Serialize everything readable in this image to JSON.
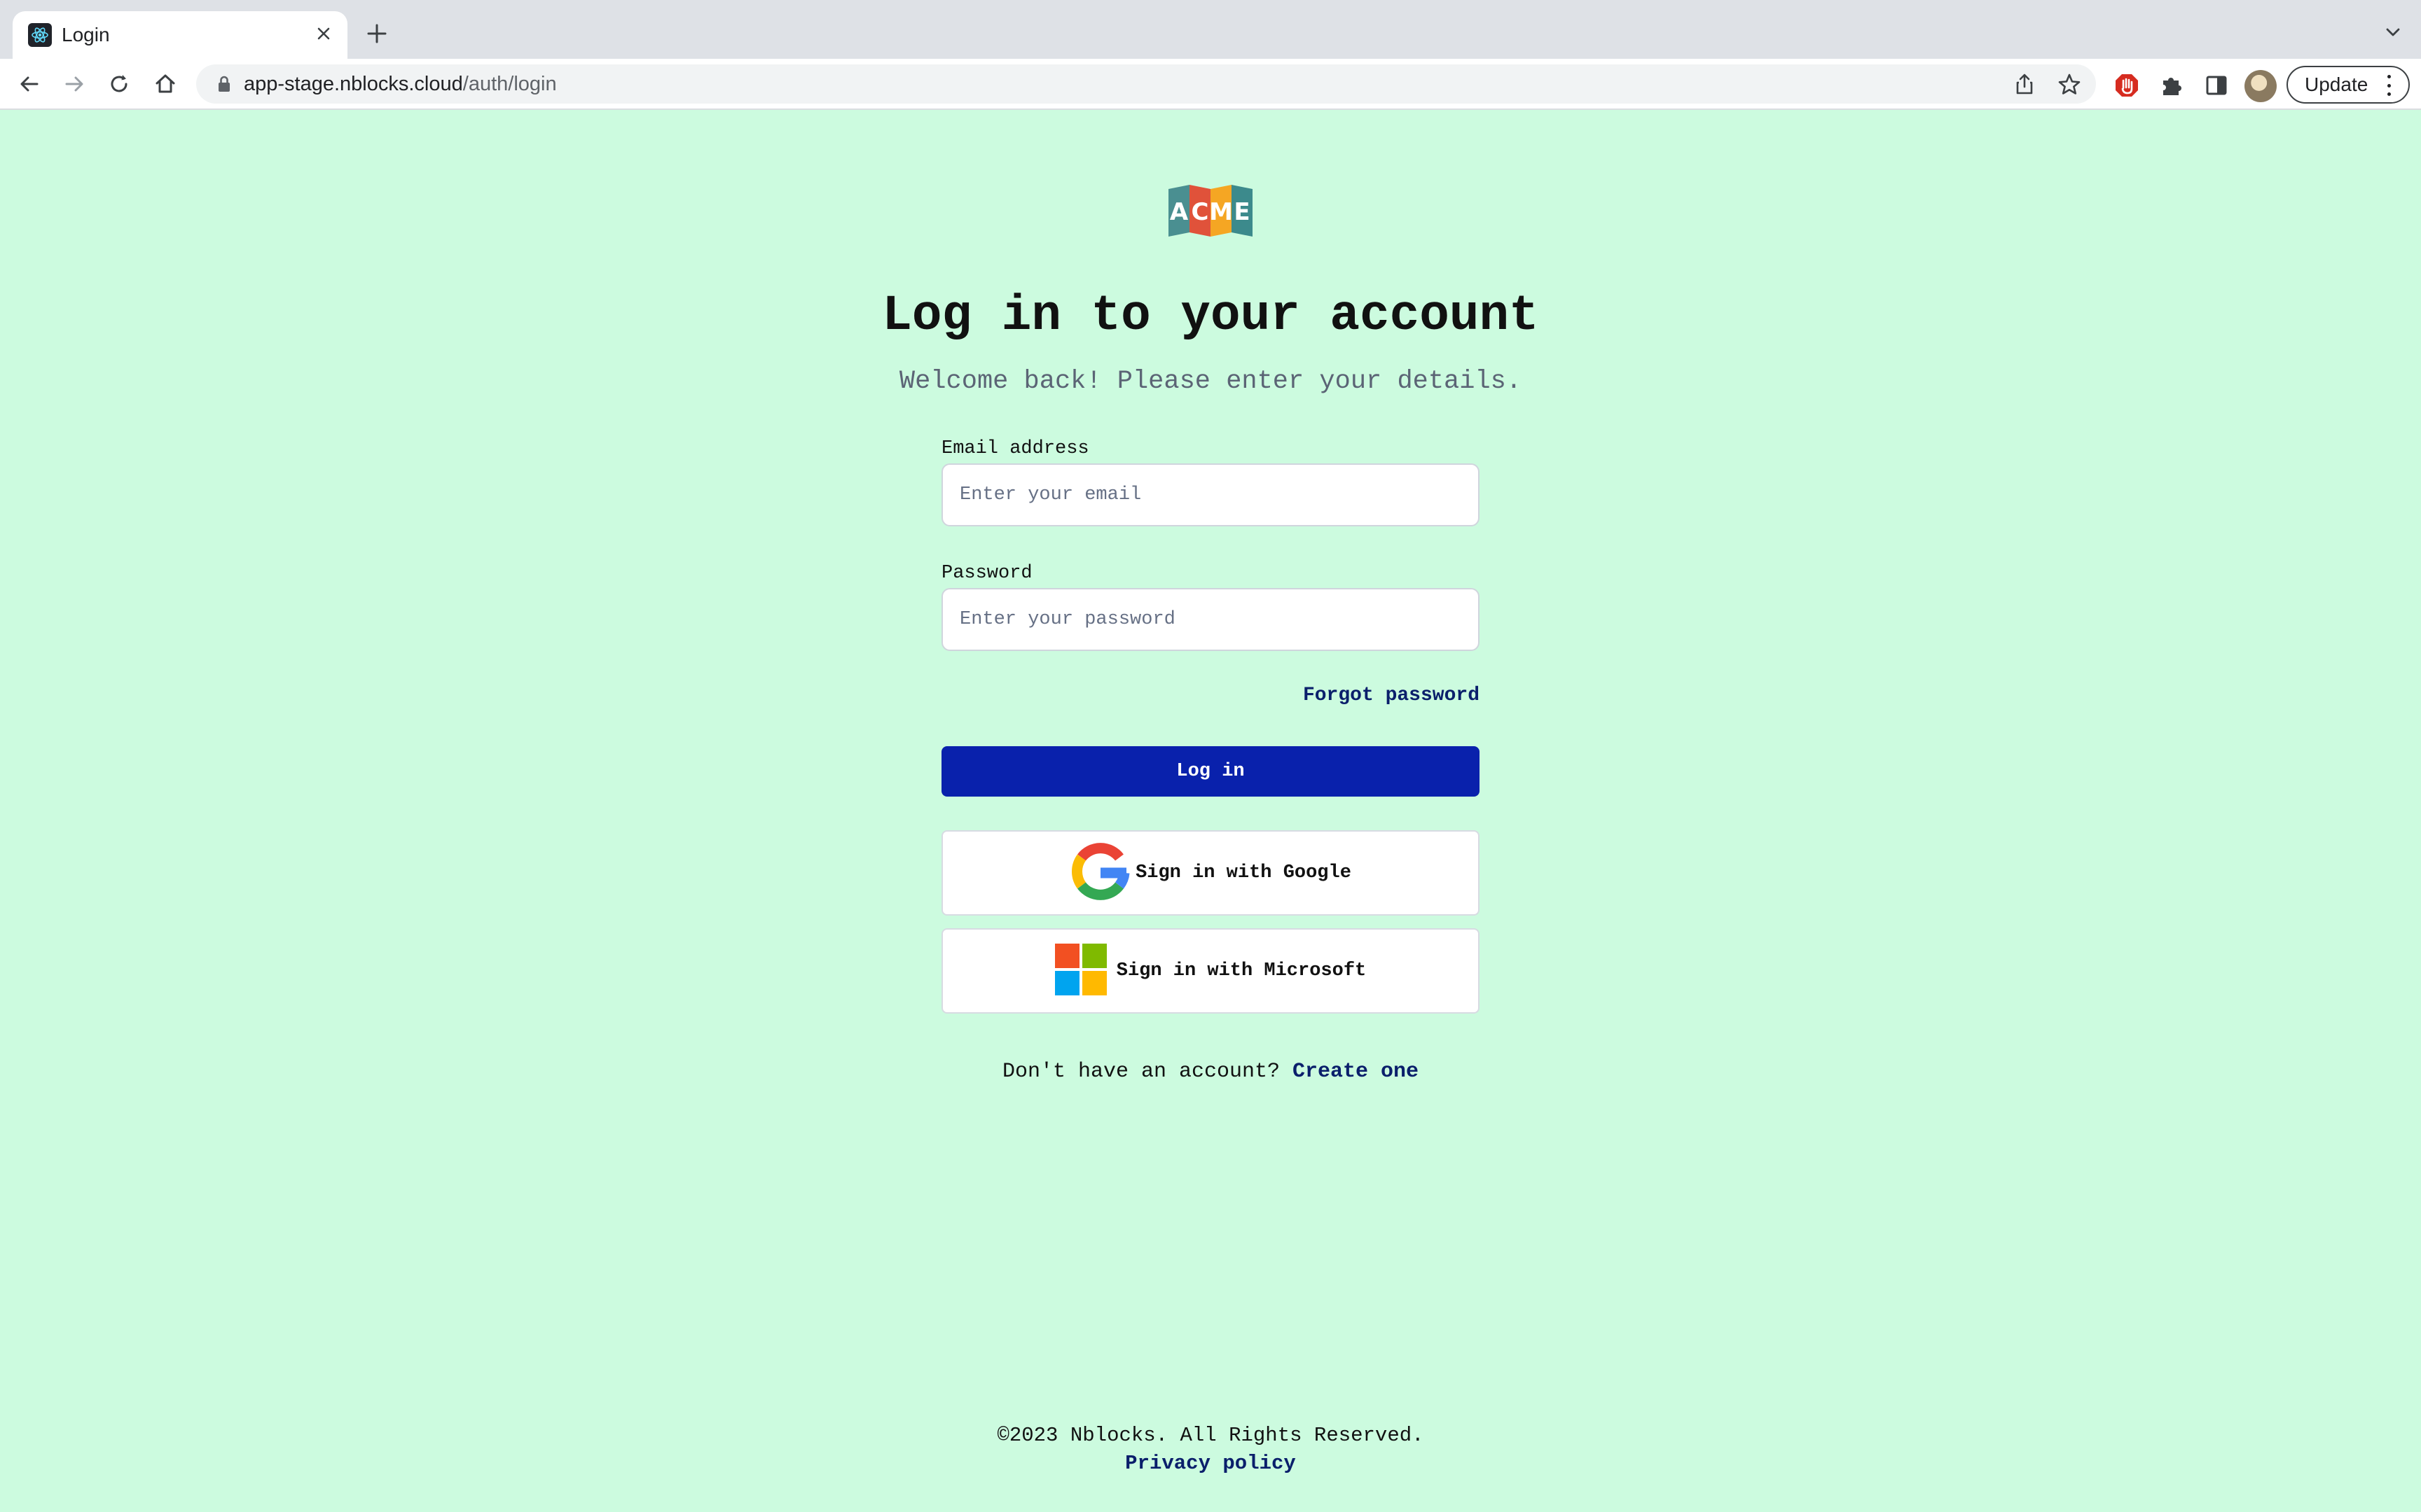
{
  "browser": {
    "tab": {
      "title": "Login",
      "favicon": "react-atom-icon"
    },
    "url": {
      "domain": "app-stage.nblocks.cloud",
      "path": "/auth/login"
    },
    "update_label": "Update"
  },
  "page": {
    "logo": {
      "letters": [
        "A",
        "C",
        "M",
        "E"
      ],
      "colors": [
        "#4a8f91",
        "#e0523a",
        "#f5a623",
        "#3c8a8c"
      ]
    },
    "title": "Log in to your account",
    "subtitle": "Welcome back! Please enter your details.",
    "email": {
      "label": "Email address",
      "placeholder": "Enter your email",
      "value": ""
    },
    "password": {
      "label": "Password",
      "placeholder": "Enter your password",
      "value": ""
    },
    "forgot_password": "Forgot password",
    "login_button": "Log in",
    "google_button": "Sign in with Google",
    "microsoft_button": "Sign in with Microsoft",
    "signup_prompt": "Don't have an account?",
    "signup_link": "Create one"
  },
  "footer": {
    "copyright": "©2023 Nblocks. All Rights Reserved.",
    "privacy": "Privacy policy"
  },
  "colors": {
    "background": "#ccfbdf",
    "primary": "#0921ac",
    "link": "#0a1f6b"
  }
}
